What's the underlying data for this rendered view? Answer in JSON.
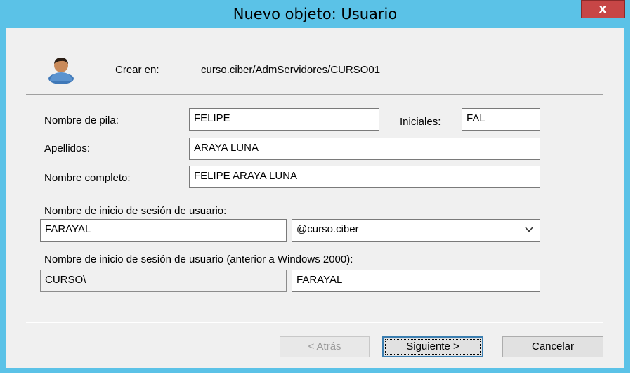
{
  "window": {
    "title": "Nuevo objeto: Usuario",
    "close_glyph": "x",
    "accent_color": "#5bc2e7"
  },
  "header": {
    "icon": "user-icon",
    "create_in_label": "Crear en:",
    "create_in_value": "curso.ciber/AdmServidores/CURSO01"
  },
  "form": {
    "first_name_label": "Nombre de pila:",
    "first_name_value": "FELIPE",
    "initials_label": "Iniciales:",
    "initials_value": "FAL",
    "last_name_label": "Apellidos:",
    "last_name_value": "ARAYA LUNA",
    "full_name_label": "Nombre completo:",
    "full_name_value": "FELIPE ARAYA LUNA",
    "logon_label": "Nombre de inicio de sesión de usuario:",
    "logon_value": "FARAYAL",
    "domain_selected": "@curso.ciber",
    "pre2000_label": "Nombre de inicio de sesión de usuario (anterior a Windows 2000):",
    "pre2000_domain": "CURSO\\",
    "pre2000_value": "FARAYAL"
  },
  "buttons": {
    "back": "< Atrás",
    "next": "Siguiente >",
    "cancel": "Cancelar"
  }
}
